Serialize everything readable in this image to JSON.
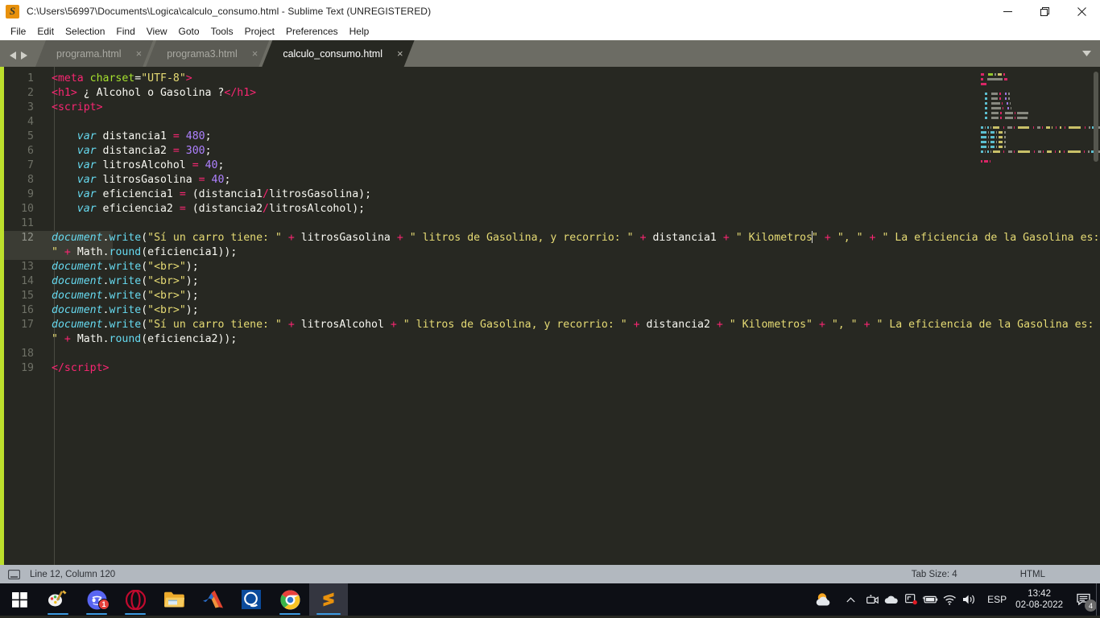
{
  "window": {
    "title": "C:\\Users\\56997\\Documents\\Logica\\calculo_consumo.html - Sublime Text (UNREGISTERED)",
    "logo_glyph": "S",
    "controls": {
      "minimize": "minimize-button",
      "maximize": "restore-button",
      "close": "close-button"
    }
  },
  "menubar": {
    "items": [
      "File",
      "Edit",
      "Selection",
      "Find",
      "View",
      "Goto",
      "Tools",
      "Project",
      "Preferences",
      "Help"
    ]
  },
  "tabs": {
    "items": [
      {
        "label": "programa.html",
        "active": false,
        "close": "×"
      },
      {
        "label": "programa3.html",
        "active": false,
        "close": "×"
      },
      {
        "label": "calculo_consumo.html",
        "active": true,
        "close": "×"
      }
    ],
    "overflow_glyph": "▼"
  },
  "editor": {
    "lines": [
      {
        "n": "1",
        "tokens": [
          {
            "c": "t-tag",
            "t": "<meta"
          },
          {
            "c": "t-plain",
            "t": " "
          },
          {
            "c": "t-attr",
            "t": "charset"
          },
          {
            "c": "t-plain",
            "t": "="
          },
          {
            "c": "t-str",
            "t": "\"UTF-8\""
          },
          {
            "c": "t-tag",
            "t": ">"
          }
        ]
      },
      {
        "n": "2",
        "tokens": [
          {
            "c": "t-tag",
            "t": "<h1>"
          },
          {
            "c": "t-plain",
            "t": " ¿ Alcohol o Gasolina ?"
          },
          {
            "c": "t-tag",
            "t": "</h1>"
          }
        ]
      },
      {
        "n": "3",
        "tokens": [
          {
            "c": "t-tag",
            "t": "<script>"
          }
        ]
      },
      {
        "n": "4",
        "tokens": []
      },
      {
        "n": "5",
        "tokens": [
          {
            "c": "t-plain",
            "t": "    "
          },
          {
            "c": "t-kw",
            "t": "var"
          },
          {
            "c": "t-plain",
            "t": " distancia1 "
          },
          {
            "c": "t-op",
            "t": "="
          },
          {
            "c": "t-plain",
            "t": " "
          },
          {
            "c": "t-num",
            "t": "480"
          },
          {
            "c": "t-plain",
            "t": ";"
          }
        ]
      },
      {
        "n": "6",
        "tokens": [
          {
            "c": "t-plain",
            "t": "    "
          },
          {
            "c": "t-kw",
            "t": "var"
          },
          {
            "c": "t-plain",
            "t": " distancia2 "
          },
          {
            "c": "t-op",
            "t": "="
          },
          {
            "c": "t-plain",
            "t": " "
          },
          {
            "c": "t-num",
            "t": "300"
          },
          {
            "c": "t-plain",
            "t": ";"
          }
        ]
      },
      {
        "n": "7",
        "tokens": [
          {
            "c": "t-plain",
            "t": "    "
          },
          {
            "c": "t-kw",
            "t": "var"
          },
          {
            "c": "t-plain",
            "t": " litrosAlcohol "
          },
          {
            "c": "t-op",
            "t": "="
          },
          {
            "c": "t-plain",
            "t": " "
          },
          {
            "c": "t-num",
            "t": "40"
          },
          {
            "c": "t-plain",
            "t": ";"
          }
        ]
      },
      {
        "n": "8",
        "tokens": [
          {
            "c": "t-plain",
            "t": "    "
          },
          {
            "c": "t-kw",
            "t": "var"
          },
          {
            "c": "t-plain",
            "t": " litrosGasolina "
          },
          {
            "c": "t-op",
            "t": "="
          },
          {
            "c": "t-plain",
            "t": " "
          },
          {
            "c": "t-num",
            "t": "40"
          },
          {
            "c": "t-plain",
            "t": ";"
          }
        ]
      },
      {
        "n": "9",
        "tokens": [
          {
            "c": "t-plain",
            "t": "    "
          },
          {
            "c": "t-kw",
            "t": "var"
          },
          {
            "c": "t-plain",
            "t": " eficiencia1 "
          },
          {
            "c": "t-op",
            "t": "="
          },
          {
            "c": "t-plain",
            "t": " (distancia1"
          },
          {
            "c": "t-op",
            "t": "/"
          },
          {
            "c": "t-plain",
            "t": "litrosGasolina);"
          }
        ]
      },
      {
        "n": "10",
        "tokens": [
          {
            "c": "t-plain",
            "t": "    "
          },
          {
            "c": "t-kw",
            "t": "var"
          },
          {
            "c": "t-plain",
            "t": " eficiencia2 "
          },
          {
            "c": "t-op",
            "t": "="
          },
          {
            "c": "t-plain",
            "t": " (distancia2"
          },
          {
            "c": "t-op",
            "t": "/"
          },
          {
            "c": "t-plain",
            "t": "litrosAlcohol);"
          }
        ]
      },
      {
        "n": "11",
        "tokens": []
      },
      {
        "n": "12",
        "current": true,
        "tokens": [
          {
            "c": "t-obj",
            "t": "document"
          },
          {
            "c": "t-plain",
            "t": "."
          },
          {
            "c": "t-fn",
            "t": "write"
          },
          {
            "c": "t-plain",
            "t": "("
          },
          {
            "c": "t-str",
            "t": "\"Sí un carro tiene: \""
          },
          {
            "c": "t-plain",
            "t": " "
          },
          {
            "c": "t-op",
            "t": "+"
          },
          {
            "c": "t-plain",
            "t": " litrosGasolina "
          },
          {
            "c": "t-op",
            "t": "+"
          },
          {
            "c": "t-plain",
            "t": " "
          },
          {
            "c": "t-str",
            "t": "\" litros de Gasolina, y recorrio: \""
          },
          {
            "c": "t-plain",
            "t": " "
          },
          {
            "c": "t-op",
            "t": "+"
          },
          {
            "c": "t-plain",
            "t": " distancia1 "
          },
          {
            "c": "t-op",
            "t": "+"
          },
          {
            "c": "t-plain",
            "t": " "
          },
          {
            "c": "t-str",
            "t": "\" Kilometros"
          },
          {
            "c": "caret",
            "t": ""
          },
          {
            "c": "t-str",
            "t": "\""
          },
          {
            "c": "t-plain",
            "t": " "
          },
          {
            "c": "t-op",
            "t": "+"
          },
          {
            "c": "t-plain",
            "t": " "
          },
          {
            "c": "t-str",
            "t": "\", \""
          },
          {
            "c": "t-plain",
            "t": " "
          },
          {
            "c": "t-op",
            "t": "+"
          },
          {
            "c": "t-plain",
            "t": " "
          },
          {
            "c": "t-str",
            "t": "\" La eficiencia de la Gasolina es: \""
          },
          {
            "c": "t-plain",
            "t": " "
          },
          {
            "c": "t-op",
            "t": "+"
          },
          {
            "c": "t-plain",
            "t": " "
          },
          {
            "c": "t-plain",
            "t": "Math."
          },
          {
            "c": "t-fn",
            "t": "round"
          },
          {
            "c": "t-plain",
            "t": "(eficiencia1));"
          }
        ]
      },
      {
        "n": "13",
        "tokens": [
          {
            "c": "t-obj",
            "t": "document"
          },
          {
            "c": "t-plain",
            "t": "."
          },
          {
            "c": "t-fn",
            "t": "write"
          },
          {
            "c": "t-plain",
            "t": "("
          },
          {
            "c": "t-str",
            "t": "\"<br>\""
          },
          {
            "c": "t-plain",
            "t": ");"
          }
        ]
      },
      {
        "n": "14",
        "tokens": [
          {
            "c": "t-obj",
            "t": "document"
          },
          {
            "c": "t-plain",
            "t": "."
          },
          {
            "c": "t-fn",
            "t": "write"
          },
          {
            "c": "t-plain",
            "t": "("
          },
          {
            "c": "t-str",
            "t": "\"<br>\""
          },
          {
            "c": "t-plain",
            "t": ");"
          }
        ]
      },
      {
        "n": "15",
        "tokens": [
          {
            "c": "t-obj",
            "t": "document"
          },
          {
            "c": "t-plain",
            "t": "."
          },
          {
            "c": "t-fn",
            "t": "write"
          },
          {
            "c": "t-plain",
            "t": "("
          },
          {
            "c": "t-str",
            "t": "\"<br>\""
          },
          {
            "c": "t-plain",
            "t": ");"
          }
        ]
      },
      {
        "n": "16",
        "tokens": [
          {
            "c": "t-obj",
            "t": "document"
          },
          {
            "c": "t-plain",
            "t": "."
          },
          {
            "c": "t-fn",
            "t": "write"
          },
          {
            "c": "t-plain",
            "t": "("
          },
          {
            "c": "t-str",
            "t": "\"<br>\""
          },
          {
            "c": "t-plain",
            "t": ");"
          }
        ]
      },
      {
        "n": "17",
        "tokens": [
          {
            "c": "t-obj",
            "t": "document"
          },
          {
            "c": "t-plain",
            "t": "."
          },
          {
            "c": "t-fn",
            "t": "write"
          },
          {
            "c": "t-plain",
            "t": "("
          },
          {
            "c": "t-str",
            "t": "\"Sí un carro tiene: \""
          },
          {
            "c": "t-plain",
            "t": " "
          },
          {
            "c": "t-op",
            "t": "+"
          },
          {
            "c": "t-plain",
            "t": " litrosAlcohol "
          },
          {
            "c": "t-op",
            "t": "+"
          },
          {
            "c": "t-plain",
            "t": " "
          },
          {
            "c": "t-str",
            "t": "\" litros de Gasolina, y recorrio: \""
          },
          {
            "c": "t-plain",
            "t": " "
          },
          {
            "c": "t-op",
            "t": "+"
          },
          {
            "c": "t-plain",
            "t": " distancia2 "
          },
          {
            "c": "t-op",
            "t": "+"
          },
          {
            "c": "t-plain",
            "t": " "
          },
          {
            "c": "t-str",
            "t": "\" Kilometros\""
          },
          {
            "c": "t-plain",
            "t": " "
          },
          {
            "c": "t-op",
            "t": "+"
          },
          {
            "c": "t-plain",
            "t": " "
          },
          {
            "c": "t-str",
            "t": "\", \""
          },
          {
            "c": "t-plain",
            "t": " "
          },
          {
            "c": "t-op",
            "t": "+"
          },
          {
            "c": "t-plain",
            "t": " "
          },
          {
            "c": "t-str",
            "t": "\" La eficiencia de la Gasolina es: \""
          },
          {
            "c": "t-plain",
            "t": " "
          },
          {
            "c": "t-op",
            "t": "+"
          },
          {
            "c": "t-plain",
            "t": " "
          },
          {
            "c": "t-plain",
            "t": "Math."
          },
          {
            "c": "t-fn",
            "t": "round"
          },
          {
            "c": "t-plain",
            "t": "(eficiencia2));"
          }
        ]
      },
      {
        "n": "18",
        "tokens": []
      },
      {
        "n": "19",
        "tokens": [
          {
            "c": "t-tag",
            "t": "</"
          },
          {
            "c": "t-tag",
            "t": "script"
          },
          {
            "c": "t-tag",
            "t": ">"
          }
        ]
      }
    ]
  },
  "statusbar": {
    "cursor": "Line 12, Column 120",
    "tab_size": "Tab Size: 4",
    "syntax": "HTML"
  },
  "taskbar": {
    "items": [
      {
        "name": "start-button",
        "label": "Start"
      },
      {
        "name": "paint-3d-icon",
        "label": "Paint 3D"
      },
      {
        "name": "discord-icon",
        "label": "Discord",
        "badge": "1"
      },
      {
        "name": "opera-icon",
        "label": "Opera"
      },
      {
        "name": "file-explorer-icon",
        "label": "File Explorer"
      },
      {
        "name": "matlab-icon",
        "label": "MATLAB"
      },
      {
        "name": "packettracer-icon",
        "label": "Cisco Packet Tracer"
      },
      {
        "name": "chrome-icon",
        "label": "Google Chrome"
      },
      {
        "name": "sublime-text-icon",
        "label": "Sublime Text"
      }
    ],
    "tray": {
      "language": "ESP",
      "time": "13:42",
      "date": "02-08-2022",
      "notification_count": "4"
    }
  },
  "colors": {
    "editor_bg": "#272822",
    "current_line": "#3b3c34",
    "active_stripe": "#bcdf2c",
    "tab_bar": "#6c6c64",
    "status_bar": "#b2b8bf",
    "taskbar": "#0d0f15",
    "accent_pink": "#f92672",
    "accent_green": "#a6e22e",
    "accent_yellow": "#e6db74",
    "accent_purple": "#ae81ff",
    "accent_cyan": "#66d9ef"
  }
}
